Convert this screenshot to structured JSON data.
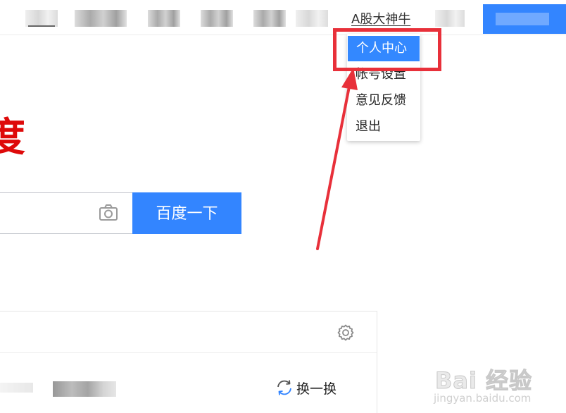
{
  "header": {
    "user_name": "A股大神牛"
  },
  "dropdown": {
    "items": [
      "个人中心",
      "帐号设置",
      "意见反馈",
      "退出"
    ],
    "active_index": 0
  },
  "logo_fragment": "度",
  "search": {
    "button_label": "百度一下"
  },
  "hot_list": {
    "refresh_label": "换一换"
  },
  "watermark": {
    "logo_text": "Bai 经验",
    "url": "jingyan.baidu.com"
  },
  "colors": {
    "brand_blue": "#3385ff",
    "logo_red": "#de0a0a",
    "annotation_red": "#e8303a"
  },
  "icons": [
    "camera-icon",
    "gear-icon",
    "refresh-icon",
    "paw-icon"
  ]
}
